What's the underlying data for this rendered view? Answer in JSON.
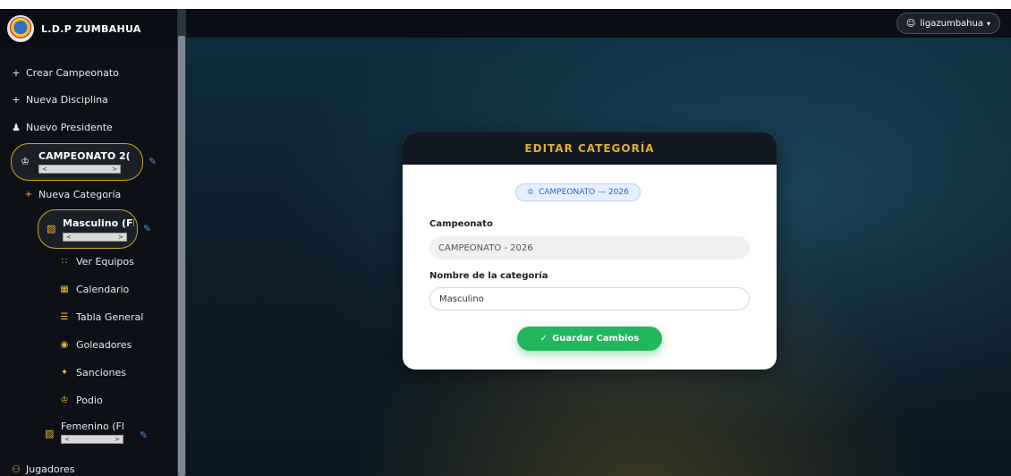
{
  "brand": {
    "name": "L.D.P ZUMBAHUA"
  },
  "sidebar": {
    "items": [
      {
        "label": "Crear Campeonato",
        "icon": "plus-icon",
        "glyph": "+"
      },
      {
        "label": "Nueva Disciplina",
        "icon": "plus-icon",
        "glyph": "+"
      },
      {
        "label": "Nuevo Presidente",
        "icon": "user-icon",
        "glyph": "♟"
      }
    ],
    "championship": {
      "label": "CAMPEONATO 2(",
      "icon": "trophy-icon",
      "glyph": "♔"
    },
    "new_category": {
      "label": "Nueva Categoría",
      "glyph": "+"
    },
    "category_male": {
      "label": "Masculino (Fl",
      "icon": "folder-icon",
      "glyph": "▨"
    },
    "sub_items": [
      {
        "label": "Ver Equipos",
        "icon": "teams-icon",
        "glyph": "∷"
      },
      {
        "label": "Calendario",
        "icon": "calendar-icon",
        "glyph": "▦"
      },
      {
        "label": "Tabla General",
        "icon": "list-icon",
        "glyph": "☰"
      },
      {
        "label": "Goleadores",
        "icon": "ball-icon",
        "glyph": "◉"
      },
      {
        "label": "Sanciones",
        "icon": "sanction-icon",
        "glyph": "✦"
      },
      {
        "label": "Podio",
        "icon": "trophy-icon",
        "glyph": "♔"
      }
    ],
    "category_female": {
      "label": "Femenino (Fl",
      "icon": "folder-icon",
      "glyph": "▨"
    },
    "players": {
      "label": "Jugadores",
      "icon": "users-icon",
      "glyph": "⚇"
    },
    "scroll_left": "<",
    "scroll_right": ">",
    "edit_glyph": "✎"
  },
  "topbar": {
    "user": "ligazumbahua",
    "user_glyph": "☺",
    "caret": "▾"
  },
  "card": {
    "title": "EDITAR CATEGORÍA",
    "badge": "CAMPEONATO — 2026",
    "badge_glyph": "♔",
    "fields": {
      "campeonato_label": "Campeonato",
      "campeonato_value": "CAMPEONATO - 2026",
      "nombre_label": "Nombre de la categoría",
      "nombre_value": "Masculino"
    },
    "save_label": "Guardar Cambios",
    "save_glyph": "✓"
  },
  "colors": {
    "accent_gold": "#e2ac2c",
    "save_green": "#23b75c",
    "badge_blue": "#2a63c4"
  }
}
